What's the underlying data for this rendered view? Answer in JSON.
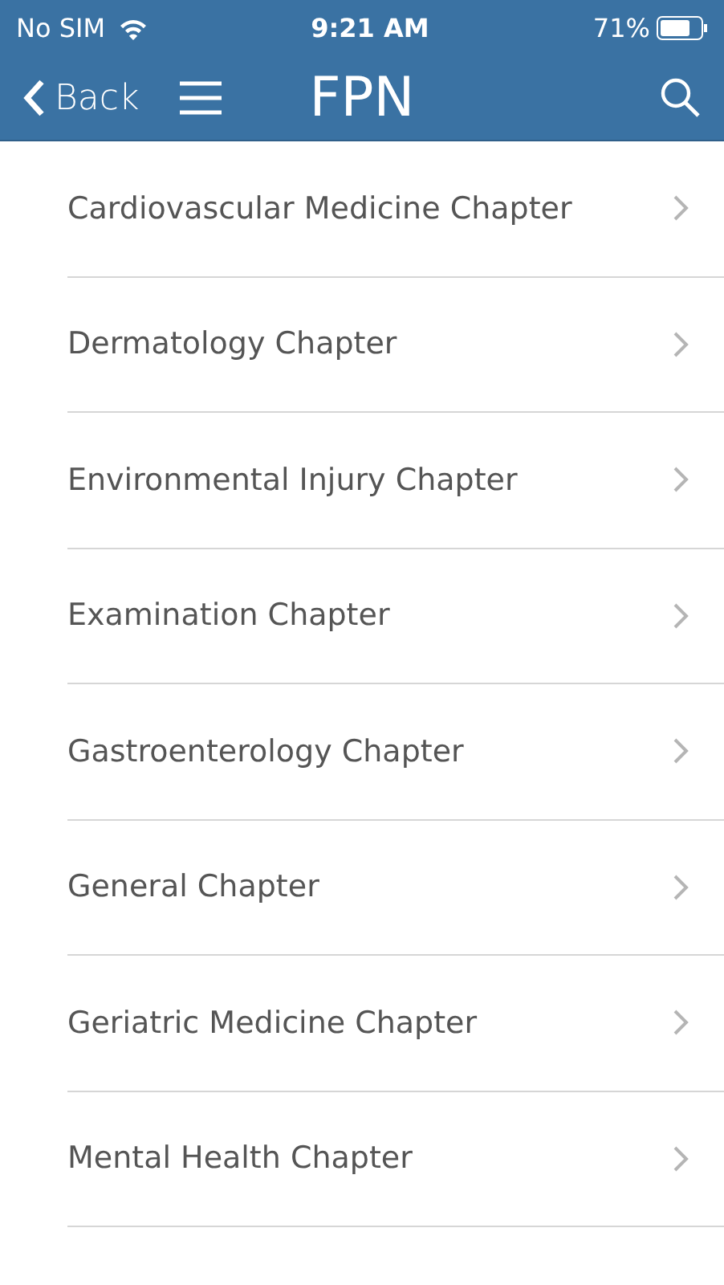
{
  "status_bar": {
    "carrier": "No SIM",
    "time": "9:21 AM",
    "battery": "71%"
  },
  "nav_bar": {
    "back": "Back",
    "title": "FPN"
  },
  "chapters": [
    {
      "label": "Cardiovascular Medicine Chapter"
    },
    {
      "label": "Dermatology Chapter"
    },
    {
      "label": "Environmental Injury Chapter"
    },
    {
      "label": "Examination Chapter"
    },
    {
      "label": "Gastroenterology Chapter"
    },
    {
      "label": "General Chapter"
    },
    {
      "label": "Geriatric Medicine Chapter"
    },
    {
      "label": "Mental Health Chapter"
    }
  ]
}
